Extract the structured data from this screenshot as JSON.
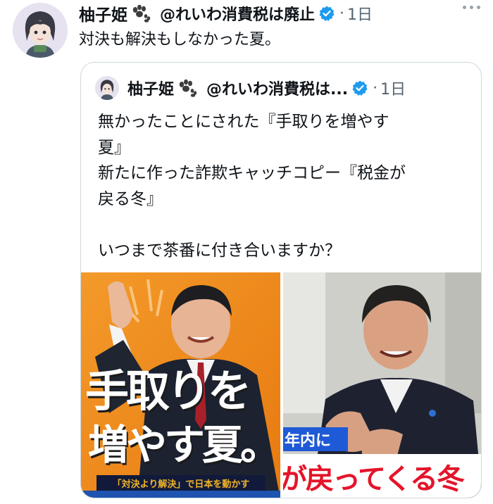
{
  "tweet": {
    "author_name": "柚子姫",
    "handle": "@れいわ消費税は廃止",
    "dot": "·",
    "time": "1日",
    "text": "対決も解決もしなかった夏。"
  },
  "quoted_tweet": {
    "author_name": "柚子姫",
    "handle": "@れいわ消費税は...",
    "dot": "·",
    "time": "1日",
    "lines": [
      "無かったことにされた『手取りを増やす",
      "夏』",
      "新たに作った詐欺キャッチコピー『税金が",
      "戻る冬』",
      "",
      "いつまで茶番に付き合いますか？"
    ]
  },
  "media": {
    "left": {
      "headline_top": "手取りを",
      "headline_bottom": "増やす夏。",
      "slogan": "「対決より解決」で日本を動かす"
    },
    "right": {
      "caption_blue": "年内に",
      "caption_red": "が戻ってくる冬"
    }
  },
  "colors": {
    "verified": "#1d9bf0",
    "poster_orange": "#f08a1c",
    "caption_red": "#e4142a",
    "caption_blue": "#1f5ad6"
  },
  "icons": [
    "paw-icon",
    "verified-badge-icon",
    "more-options-icon"
  ]
}
